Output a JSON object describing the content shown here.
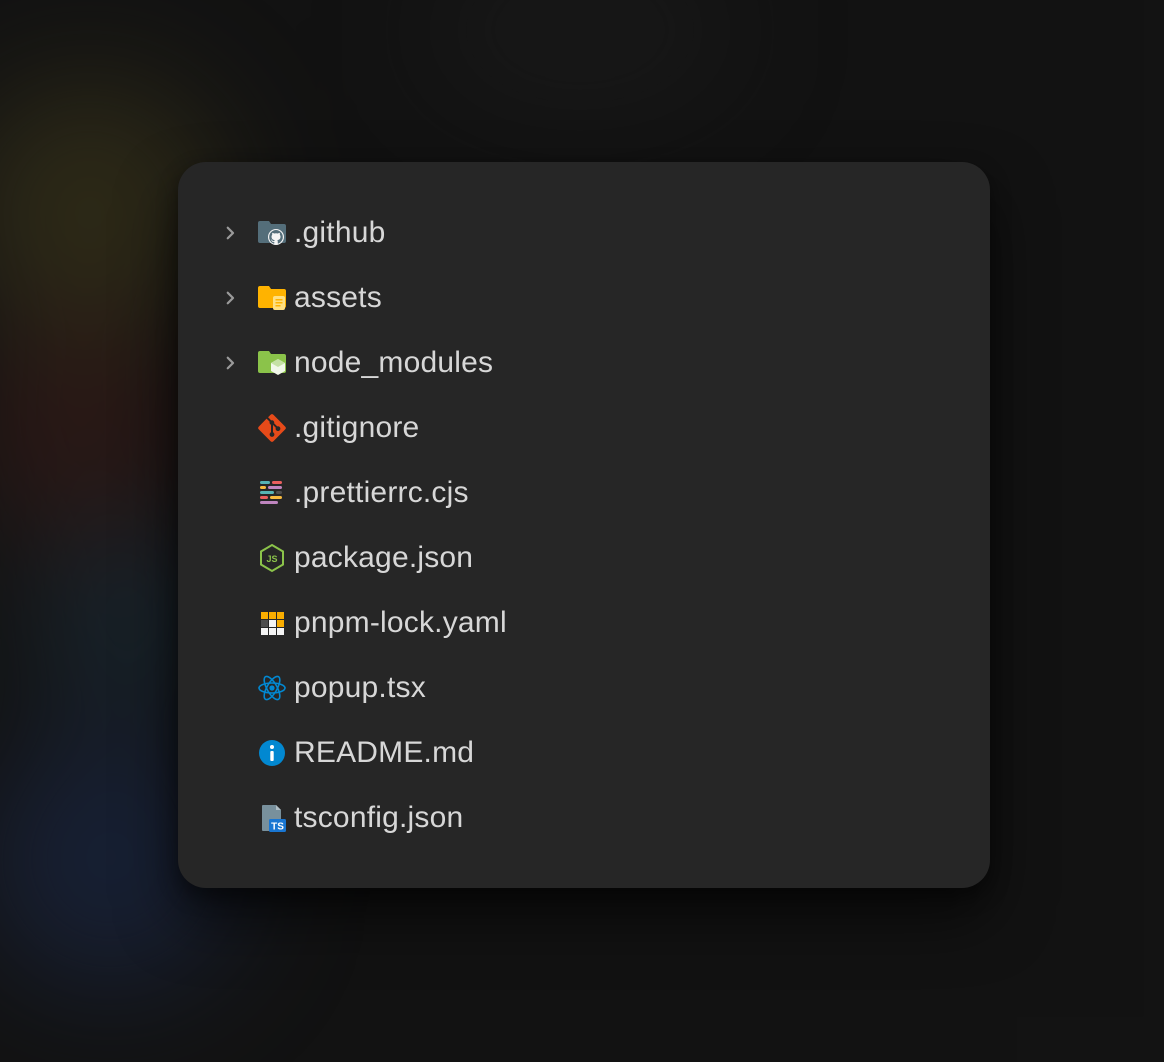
{
  "tree": {
    "items": [
      {
        "type": "folder",
        "label": ".github",
        "icon": "github-folder"
      },
      {
        "type": "folder",
        "label": "assets",
        "icon": "assets-folder"
      },
      {
        "type": "folder",
        "label": "node_modules",
        "icon": "node-modules-folder"
      },
      {
        "type": "file",
        "label": ".gitignore",
        "icon": "git"
      },
      {
        "type": "file",
        "label": ".prettierrc.cjs",
        "icon": "prettier"
      },
      {
        "type": "file",
        "label": "package.json",
        "icon": "nodejs"
      },
      {
        "type": "file",
        "label": "pnpm-lock.yaml",
        "icon": "pnpm"
      },
      {
        "type": "file",
        "label": "popup.tsx",
        "icon": "react"
      },
      {
        "type": "file",
        "label": "README.md",
        "icon": "readme"
      },
      {
        "type": "file",
        "label": "tsconfig.json",
        "icon": "tsconfig"
      }
    ]
  },
  "colors": {
    "panel_bg": "#262626",
    "text": "#d7d7d7",
    "chevron": "#9a9a9a"
  }
}
